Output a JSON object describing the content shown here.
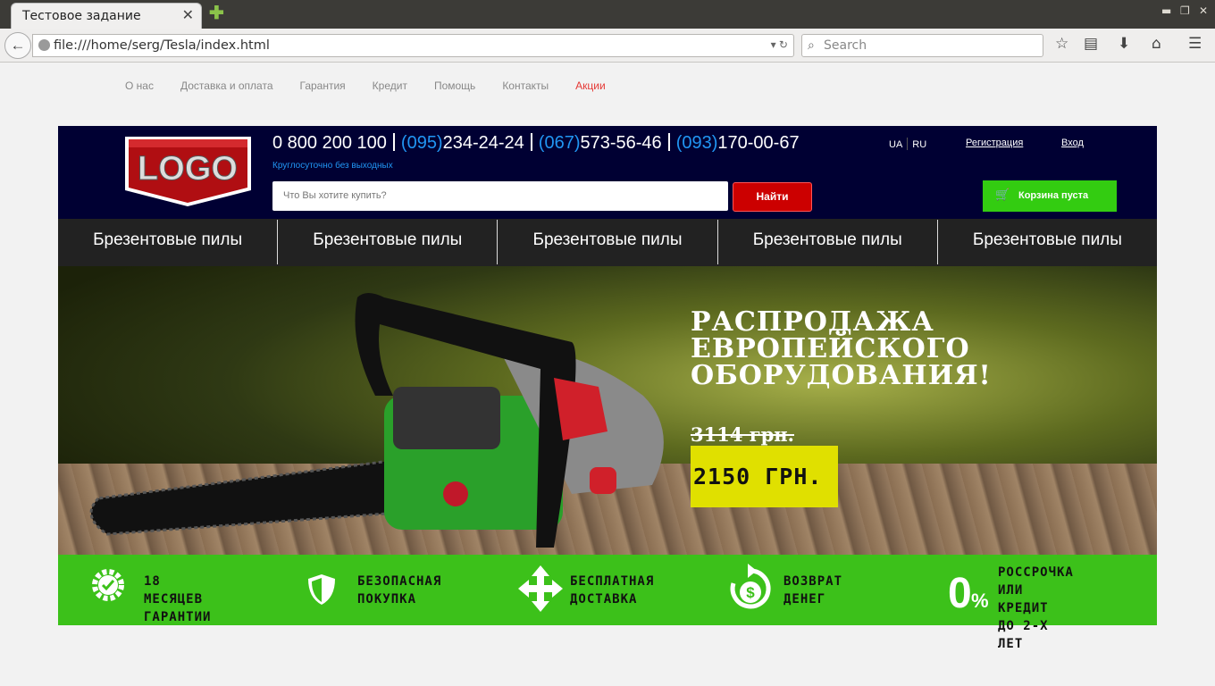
{
  "browser": {
    "tab_title": "Тестовое задание",
    "url": "file:///home/serg/Tesla/index.html",
    "search_placeholder": "Search"
  },
  "topnav": [
    "О нас",
    "Доставка и оплата",
    "Гарантия",
    "Кредит",
    "Помощь",
    "Контакты",
    "Акции"
  ],
  "header": {
    "logo_text": "LOGO",
    "phones": [
      {
        "code": "",
        "number": "0 800 200 100"
      },
      {
        "code": "(095)",
        "number": "234-24-24"
      },
      {
        "code": "(067)",
        "number": "573-56-46"
      },
      {
        "code": "(093)",
        "number": "170-00-67"
      }
    ],
    "hours": "Круглосуточно без выходных",
    "search_placeholder": "Что Вы хотите купить?",
    "find_button": "Найти",
    "lang_ua": "UA",
    "lang_ru": "RU",
    "register": "Регистрация",
    "login": "Вход",
    "cart": "Корзина пуста"
  },
  "categories": [
    "Брезентовые пилы",
    "Брезентовые пилы",
    "Брезентовые пилы",
    "Брезентовые пилы",
    "Брезентовые пилы"
  ],
  "banner": {
    "headline": [
      "РАСПРОДАЖА",
      "ЕВРОПЕЙСКОГО",
      "ОБОРУДОВАНИЯ!"
    ],
    "old_price": "3114 грн.",
    "new_price": "2150 ГРН."
  },
  "benefits": [
    {
      "icon": "gear-check-icon",
      "lines": [
        "18 МЕСЯЦЕВ",
        "ГАРАНТИИ"
      ]
    },
    {
      "icon": "shield-icon",
      "lines": [
        "БЕЗОПАСНАЯ",
        "ПОКУПКА"
      ]
    },
    {
      "icon": "arrows-icon",
      "lines": [
        "БЕСПЛАТНАЯ",
        "ДОСТАВКА"
      ]
    },
    {
      "icon": "money-back-icon",
      "lines": [
        "ВОЗВРАТ",
        "ДЕНЕГ"
      ]
    },
    {
      "icon": "zero-percent-icon",
      "lines": [
        "РОССРОЧКА",
        "ИЛИ КРЕДИТ",
        "ДО 2-Х ЛЕТ"
      ]
    }
  ],
  "colors": {
    "header_bg": "#000033",
    "accent_blue": "#2196f3",
    "cart_green": "#33cc11",
    "find_red": "#cc0000",
    "price_yellow": "#e0e000",
    "benefits_green": "#3cc11a"
  }
}
